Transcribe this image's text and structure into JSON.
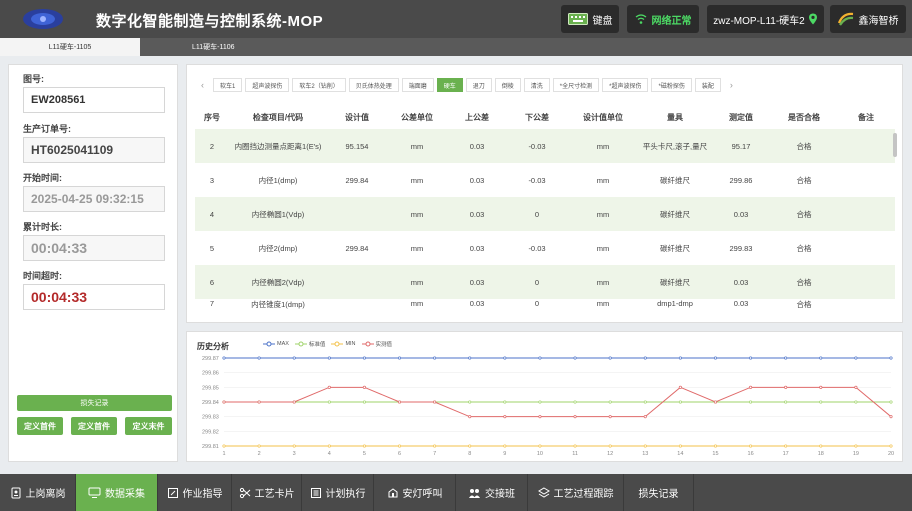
{
  "header": {
    "title": "数字化智能制造与控制系统-MOP",
    "keyboard": "键盘",
    "network": "网络正常",
    "device": "zwz-MOP-L11-硬车2",
    "brand": "鑫海智桥"
  },
  "tabs": {
    "active": "L11硬车-1105",
    "inactive": "L11硬车-1106"
  },
  "left": {
    "drawing_label": "图号:",
    "drawing_value": "EW208561",
    "order_label": "生产订单号:",
    "order_value": "HT6025041109",
    "start_label": "开始时间:",
    "start_value": "2025-04-25 09:32:15",
    "elapsed_label": "累计时长:",
    "elapsed_value": "00:04:33",
    "overtime_label": "时间超时:",
    "overtime_value": "00:04:33",
    "loss_button": "损失记录",
    "btn_first": "定义首件",
    "btn_mid": "定义首件",
    "btn_last": "定义末件"
  },
  "subtabs": [
    "软车1",
    "超声波探伤",
    "软车2（钻削）",
    "贝氏体热处理",
    "端面磨",
    "硬车",
    "退刀",
    "倒棱",
    "清洗",
    "*全尺寸检测",
    "*超声波探伤",
    "*磁粉探伤",
    "装配"
  ],
  "active_subtab_index": 5,
  "table": {
    "headers": [
      "序号",
      "检查项目/代码",
      "设计值",
      "公差单位",
      "上公差",
      "下公差",
      "设计值单位",
      "量具",
      "测定值",
      "是否合格",
      "备注"
    ],
    "rows": [
      [
        "2",
        "内圈挡边测量点距离1(E's)",
        "95.154",
        "mm",
        "0.03",
        "-0.03",
        "mm",
        "平头卡尺,滚子,量尺",
        "95.17",
        "合格",
        ""
      ],
      [
        "3",
        "内径1(dmp)",
        "299.84",
        "mm",
        "0.03",
        "-0.03",
        "mm",
        "碳纤维尺",
        "299.86",
        "合格",
        ""
      ],
      [
        "4",
        "内径椭圆1(Vdp)",
        "",
        "mm",
        "0.03",
        "0",
        "mm",
        "碳纤维尺",
        "0.03",
        "合格",
        ""
      ],
      [
        "5",
        "内径2(dmp)",
        "299.84",
        "mm",
        "0.03",
        "-0.03",
        "mm",
        "碳纤维尺",
        "299.83",
        "合格",
        ""
      ],
      [
        "6",
        "内径椭圆2(Vdp)",
        "",
        "mm",
        "0.03",
        "0",
        "mm",
        "碳纤维尺",
        "0.03",
        "合格",
        ""
      ],
      [
        "7",
        "内径锥度1(dmp)",
        "",
        "mm",
        "0.03",
        "0",
        "mm",
        "dmp1-dmp",
        "0.03",
        "合格",
        ""
      ]
    ]
  },
  "history": {
    "title": "历史分析",
    "legend": [
      "MAX",
      "标准值",
      "MIN",
      "实测值"
    ]
  },
  "chart_data": {
    "type": "line",
    "x": [
      1,
      2,
      3,
      4,
      5,
      6,
      7,
      8,
      9,
      10,
      11,
      12,
      13,
      14,
      15,
      16,
      17,
      18,
      19,
      20
    ],
    "series": [
      {
        "name": "MAX",
        "color": "#4b72c8",
        "values": [
          299.87,
          299.87,
          299.87,
          299.87,
          299.87,
          299.87,
          299.87,
          299.87,
          299.87,
          299.87,
          299.87,
          299.87,
          299.87,
          299.87,
          299.87,
          299.87,
          299.87,
          299.87,
          299.87,
          299.87
        ]
      },
      {
        "name": "标准值",
        "color": "#9fd36a",
        "values": [
          299.84,
          299.84,
          299.84,
          299.84,
          299.84,
          299.84,
          299.84,
          299.84,
          299.84,
          299.84,
          299.84,
          299.84,
          299.84,
          299.84,
          299.84,
          299.84,
          299.84,
          299.84,
          299.84,
          299.84
        ]
      },
      {
        "name": "MIN",
        "color": "#f3c24a",
        "values": [
          299.81,
          299.81,
          299.81,
          299.81,
          299.81,
          299.81,
          299.81,
          299.81,
          299.81,
          299.81,
          299.81,
          299.81,
          299.81,
          299.81,
          299.81,
          299.81,
          299.81,
          299.81,
          299.81,
          299.81
        ]
      },
      {
        "name": "实测值",
        "color": "#e06a6a",
        "values": [
          299.84,
          299.84,
          299.84,
          299.85,
          299.85,
          299.84,
          299.84,
          299.83,
          299.83,
          299.83,
          299.83,
          299.83,
          299.83,
          299.85,
          299.84,
          299.85,
          299.85,
          299.85,
          299.85,
          299.83
        ]
      }
    ],
    "y_ticks": [
      "299.87",
      "299.86",
      "299.85",
      "299.84",
      "299.83",
      "299.82",
      "299.81"
    ],
    "ylim": [
      299.81,
      299.87
    ],
    "grid": true
  },
  "bottom_nav": [
    "上岗离岗",
    "数据采集",
    "作业指导",
    "工艺卡片",
    "计划执行",
    "安灯呼叫",
    "交接班",
    "工艺过程跟踪",
    "损失记录"
  ],
  "bottom_active_index": 1
}
